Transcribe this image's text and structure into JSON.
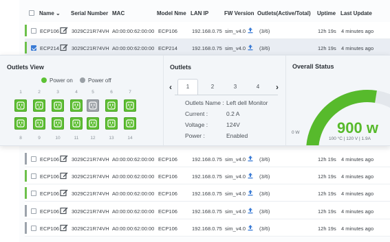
{
  "header": {
    "name": "Name",
    "serial": "Serial Number",
    "mac": "MAC",
    "model": "Model Nme",
    "lan": "LAN IP",
    "fw": "FW Version",
    "outlets": "Outlets(Active/Total)",
    "uptime": "Uptime",
    "last_update": "Last Update"
  },
  "rows": [
    {
      "name": "ECP106",
      "serial": "3029C21R74VH",
      "mac": "A0:00:00:62:00:00",
      "model": "ECP106",
      "ip": "192.168.0.75",
      "fw": "sim_v4.0",
      "outlets": "(3/6)",
      "uptime": "12h 19s",
      "updated": "4 minutes ago",
      "status": "on",
      "checked": false
    },
    {
      "name": "ECP214",
      "serial": "3029C21R74VH",
      "mac": "A0:00:00:62:00:00",
      "model": "ECP214",
      "ip": "192.168.0.75",
      "fw": "sim_v4.0",
      "outlets": "(3/6)",
      "uptime": "12h 19s",
      "updated": "4 minutes ago",
      "status": "on",
      "checked": true
    },
    {
      "name": "ECP106",
      "serial": "3029C21R74VH",
      "mac": "A0:00:00:62:00:00",
      "model": "ECP106",
      "ip": "192.168.0.75",
      "fw": "sim_v4.0",
      "outlets": "(3/6)",
      "uptime": "12h 19s",
      "updated": "4 minutes ago",
      "status": "off",
      "checked": false
    },
    {
      "name": "ECP106",
      "serial": "3029C21R74VH",
      "mac": "A0:00:00:62:00:00",
      "model": "ECP106",
      "ip": "192.168.0.75",
      "fw": "sim_v4.0",
      "outlets": "(3/6)",
      "uptime": "12h 19s",
      "updated": "4 minutes ago",
      "status": "on",
      "checked": false
    },
    {
      "name": "ECP106",
      "serial": "3029C21R74VH",
      "mac": "A0:00:00:62:00:00",
      "model": "ECP106",
      "ip": "192.168.0.75",
      "fw": "sim_v4.0",
      "outlets": "(3/6)",
      "uptime": "12h 19s",
      "updated": "4 minutes ago",
      "status": "on",
      "checked": false
    },
    {
      "name": "ECP106",
      "serial": "3029C21R74VH",
      "mac": "A0:00:00:62:00:00",
      "model": "ECP106",
      "ip": "192.168.0.75",
      "fw": "sim_v4.0",
      "outlets": "(3/6)",
      "uptime": "12h 19s",
      "updated": "4 minutes ago",
      "status": "off",
      "checked": false
    },
    {
      "name": "ECP106",
      "serial": "3029C21R74VH",
      "mac": "A0:00:00:62:00:00",
      "model": "ECP106",
      "ip": "192.168.0.75",
      "fw": "sim_v4.0",
      "outlets": "(3/6)",
      "uptime": "12h 19s",
      "updated": "4 minutes ago",
      "status": "off",
      "checked": false
    }
  ],
  "outlets_view": {
    "title": "Outlets View",
    "legend_on": "Power on",
    "legend_off": "Power off",
    "top_numbers": [
      "1",
      "2",
      "3",
      "4",
      "5",
      "6",
      "7"
    ],
    "bottom_numbers": [
      "8",
      "9",
      "10",
      "11",
      "12",
      "13",
      "14"
    ],
    "top_states": [
      "on",
      "on",
      "on",
      "on",
      "off",
      "on",
      "on"
    ],
    "bottom_states": [
      "on",
      "on",
      "on",
      "on",
      "on",
      "on",
      "on"
    ]
  },
  "outlets": {
    "title": "Outlets",
    "tabs": [
      "1",
      "2",
      "3",
      "4"
    ],
    "active_tab": "1",
    "labels": {
      "name": "Outlets Name :",
      "current": "Current :",
      "voltage": "Voltage :",
      "power": "Power :"
    },
    "values": {
      "name": "Left dell Monitor",
      "current": "0.2 A",
      "voltage": "124V",
      "power": "Enabled"
    }
  },
  "overall": {
    "title": "Overall Status",
    "watts": "900 w",
    "detail": "100 °C | 120 V | 1.9A",
    "zero": "0 W",
    "gauge_fraction": 0.55,
    "color": "#57ba2c"
  },
  "colors": {
    "on": "#5fbf34",
    "off": "#9ea3a8",
    "accent": "#3a7bd5"
  }
}
